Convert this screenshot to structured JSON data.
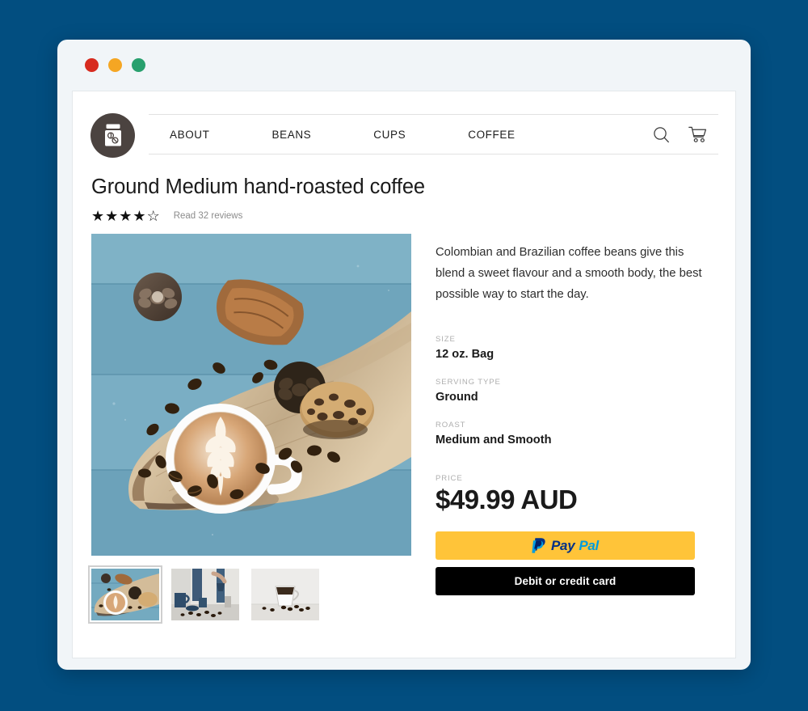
{
  "window": {
    "controls": [
      {
        "name": "close",
        "color": "#D72B1F"
      },
      {
        "name": "minimize",
        "color": "#F5A623"
      },
      {
        "name": "maximize",
        "color": "#28A06E"
      }
    ],
    "background_color": "#024E80",
    "chrome_color": "#F1F5F8"
  },
  "site": {
    "logo_alt": "coffee-jar-logo",
    "nav": [
      {
        "label": "ABOUT"
      },
      {
        "label": "BEANS"
      },
      {
        "label": "CUPS"
      },
      {
        "label": "COFFEE"
      }
    ],
    "icons": [
      {
        "name": "search-icon",
        "label": "Search"
      },
      {
        "name": "cart-icon",
        "label": "Cart"
      }
    ]
  },
  "product": {
    "title": "Ground Medium hand-roasted coffee",
    "rating": {
      "value": 4,
      "max": 5,
      "filled_glyph": "★",
      "empty_glyph": "☆",
      "reviews_text": "Read 32 reviews",
      "review_count": 32
    },
    "description": "Colombian and Brazilian coffee beans give this blend a sweet flavour and a smooth body, the best possible way to start the day.",
    "specs": [
      {
        "label": "SIZE",
        "value": "12 oz. Bag"
      },
      {
        "label": "SERVING TYPE",
        "value": "Ground"
      },
      {
        "label": "ROAST",
        "value": "Medium and Smooth"
      }
    ],
    "price": {
      "label": "PRICE",
      "value": "$49.99 AUD"
    },
    "gallery": {
      "main_alt": "latte-art-cup-on-wooden-board",
      "thumbnails": [
        {
          "alt": "latte-art-cup-on-wooden-board",
          "selected": true
        },
        {
          "alt": "blue-pitcher-pour-over-scene",
          "selected": false
        },
        {
          "alt": "dark-coffee-cup-with-beans",
          "selected": false
        }
      ]
    },
    "checkout": {
      "paypal": {
        "pay": "Pay",
        "pal": "Pal",
        "aria": "PayPal"
      },
      "card_label": "Debit or credit card",
      "paypal_color": "#FFC439",
      "card_color": "#000000"
    }
  }
}
